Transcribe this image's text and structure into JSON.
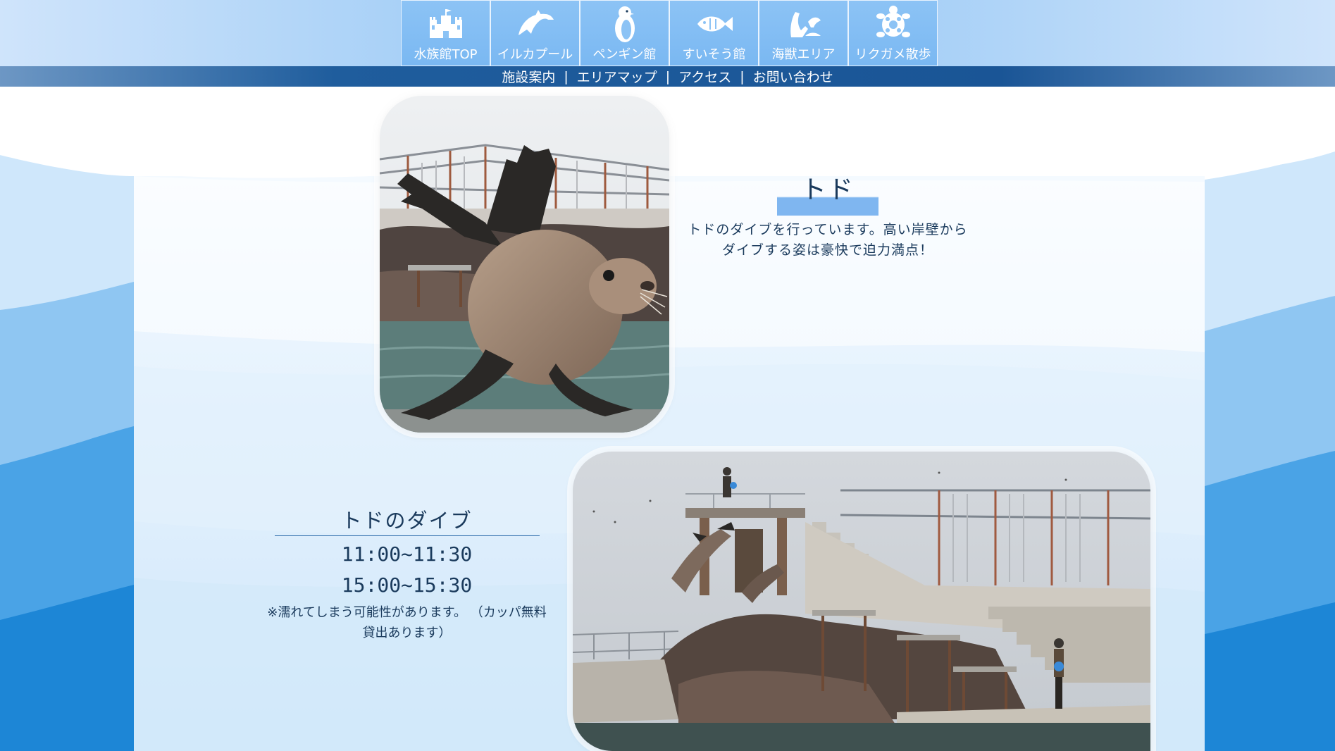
{
  "nav": {
    "items": [
      {
        "label": "水族館TOP",
        "icon": "castle-icon"
      },
      {
        "label": "イルカプール",
        "icon": "dolphin-icon"
      },
      {
        "label": "ペンギン館",
        "icon": "penguin-icon"
      },
      {
        "label": "すいそう館",
        "icon": "fish-icon"
      },
      {
        "label": "海獣エリア",
        "icon": "sea-lion-icon"
      },
      {
        "label": "リクガメ散歩",
        "icon": "turtle-icon"
      }
    ]
  },
  "subnav": {
    "items": [
      "施設案内",
      "エリアマップ",
      "アクセス",
      "お問い合わせ"
    ],
    "separator": "|"
  },
  "feature": {
    "title": "トド",
    "description_line1": "トドのダイブを行っています。高い岸壁から",
    "description_line2": "ダイブする姿は豪快で迫力満点！"
  },
  "schedule": {
    "title": "トドのダイブ",
    "time1": "11:00~11:30",
    "time2": "15:00~15:30",
    "note_line1": "※濡れてしまう可能性があります。 （カッパ無料",
    "note_line2": "貸出あります）"
  },
  "colors": {
    "nav_bg": "#7ab8f2",
    "subbar_bg": "#1a5596",
    "title_highlight": "#7fb6f0",
    "text": "#1a3a5c"
  }
}
